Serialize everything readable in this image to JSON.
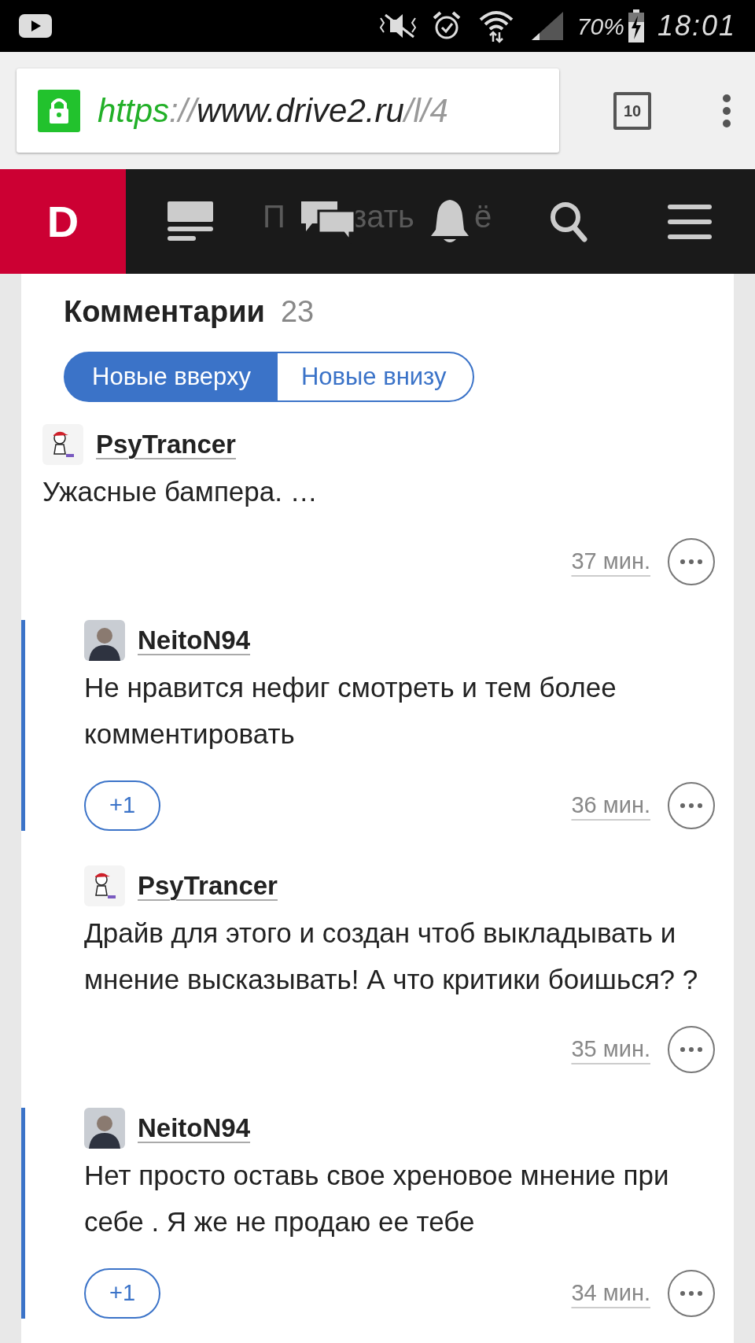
{
  "status_bar": {
    "battery": "70%",
    "time": "18:01"
  },
  "browser": {
    "url_parts": [
      {
        "kind": "scheme",
        "text": "https"
      },
      {
        "kind": "sep",
        "text": "://"
      },
      {
        "kind": "host",
        "text": "www.drive2.ru"
      },
      {
        "kind": "path",
        "text": "/l/4"
      }
    ],
    "tab_count": "10"
  },
  "nav": {
    "logo": "D",
    "ghost_text": [
      {
        "text": "П"
      },
      {
        "text": "зать"
      },
      {
        "text": "ё"
      }
    ]
  },
  "comments": {
    "title": "Комментарии",
    "count": "23",
    "tabs": [
      {
        "label": "Новые вверху",
        "selected": true
      },
      {
        "label": "Новые внизу",
        "selected": false
      }
    ],
    "items": [
      {
        "author": "PsyTrancer",
        "kind": "cap",
        "text": "Ужасные бампера. …",
        "time": "37 мин.",
        "children": [
          {
            "author": "NeitoN94",
            "kind": "person",
            "text": "Не нравится нефиг смотреть и тем более комментировать",
            "time": "36 мин.",
            "plus": "+1",
            "highlighted": true
          },
          {
            "author": "PsyTrancer",
            "kind": "cap",
            "text": "Драйв для этого и создан чтоб выкладывать и мнение высказывать! А что критики боишься? ?",
            "time": "35 мин.",
            "highlighted": false
          },
          {
            "author": "NeitoN94",
            "kind": "person",
            "text": "Нет просто оставь свое хреновое мнение при себе . Я же не продаю ее тебе",
            "time": "34 мин.",
            "plus": "+1",
            "highlighted": true
          }
        ]
      }
    ]
  }
}
